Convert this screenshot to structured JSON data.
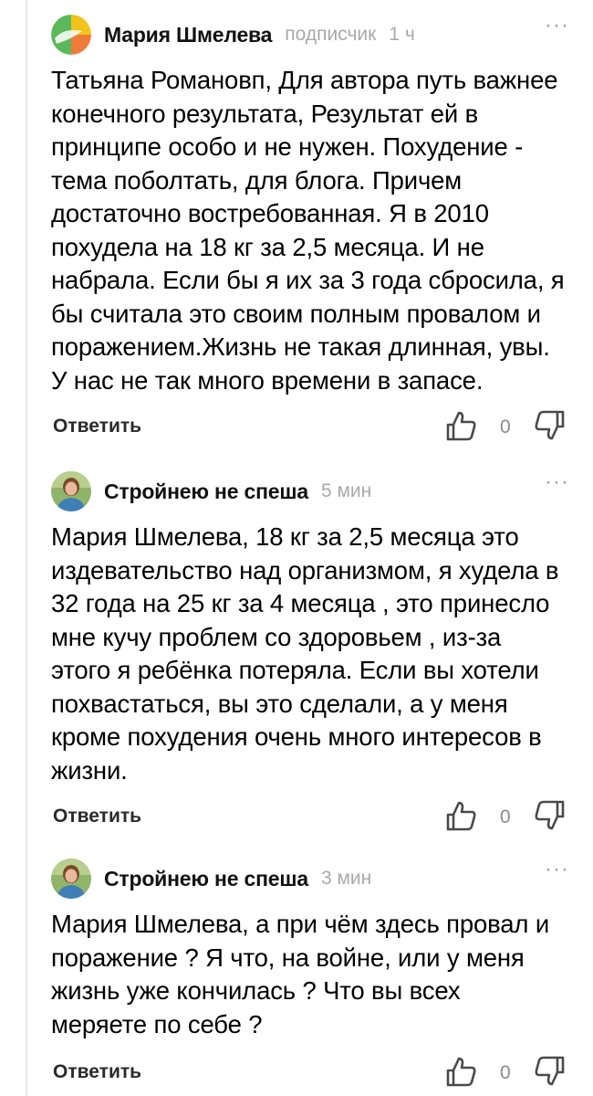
{
  "comments": [
    {
      "author": "Мария Шмелева",
      "subscriber": "подписчик",
      "time": "1 ч",
      "text": "Татьяна Романовп, Для автора путь важнее\nконечного результата, Результат ей в\nпринципе особо и не нужен. Похудение -\nтема поболтать, для блога. Причем\nдостаточно востребованная. Я в 2010\nпохудела на 18 кг за 2,5 месяца. И не\nнабрала. Если бы я их за 3 года сбросила, я\nбы считала это своим полным провалом и\nпоражением.Жизнь не такая длинная, увы.\nУ нас не так много времени в запасе.",
      "reply_label": "Ответить",
      "likes": "0",
      "more": "···"
    },
    {
      "author": "Стройнею не спеша",
      "time": "5 мин",
      "text": "Мария Шмелева, 18 кг за 2,5 месяца это\nиздевательство над организмом, я худела в\n32 года на 25 кг за 4 месяца , это принесло\nмне кучу проблем со здоровьем , из-за\nэтого я ребёнка потеряла. Если вы хотели\nпохвастаться, вы это сделали, а у меня\nкроме похудения очень много интересов в\nжизни.",
      "reply_label": "Ответить",
      "likes": "0",
      "more": "···"
    },
    {
      "author": "Стройнею не спеша",
      "time": "3 мин",
      "text": "Мария Шмелева, а при чём здесь провал и\nпоражение ? Я что, на войне, или у меня\nжизнь уже кончилась ? Что вы всех\nмеряете по себе ?",
      "reply_label": "Ответить",
      "likes": "0",
      "more": "···"
    }
  ],
  "colors": {
    "author": "#111111",
    "meta": "#a9a9a9",
    "text": "#000000",
    "icon": "#4a4a4a",
    "avatar_green": "#5cb85c",
    "avatar_yellow": "#f0c419",
    "avatar_orange": "#ef7a3a"
  },
  "icons": {
    "like": "thumbs-up-icon",
    "dislike": "thumbs-down-icon",
    "more": "more-dots-icon"
  }
}
